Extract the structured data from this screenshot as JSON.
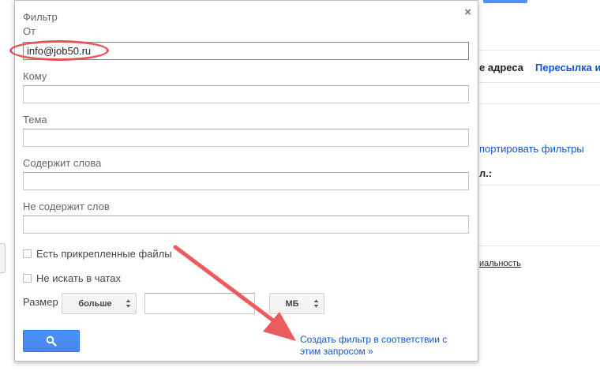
{
  "background": {
    "tab_addresses": "е адреса",
    "tab_forwarding": "Пересылка и",
    "import_filters_link": "портировать фильтры",
    "partial_label": "л.:",
    "privacy_link": "иальность"
  },
  "dialog": {
    "title": "Фильтр",
    "close_glyph": "×",
    "from": {
      "label": "От",
      "value": "info@job50.ru"
    },
    "to": {
      "label": "Кому",
      "value": ""
    },
    "subject": {
      "label": "Тема",
      "value": ""
    },
    "has_words": {
      "label": "Содержит слова",
      "value": ""
    },
    "doesnt_have": {
      "label": "Не содержит слов",
      "value": ""
    },
    "has_attachment": {
      "label": "Есть прикрепленные файлы",
      "checked": false
    },
    "dont_include_chats": {
      "label": "Не искать в чатах",
      "checked": false
    },
    "size": {
      "label": "Размер",
      "operator": "больше",
      "value": "",
      "unit": "МБ"
    },
    "search_button_icon": "search-icon",
    "create_filter_link": "Создать фильтр в соответствии с этим запросом »"
  },
  "annotations": {
    "highlight_color": "#e0565b",
    "arrow_color": "#ec5b5e"
  }
}
